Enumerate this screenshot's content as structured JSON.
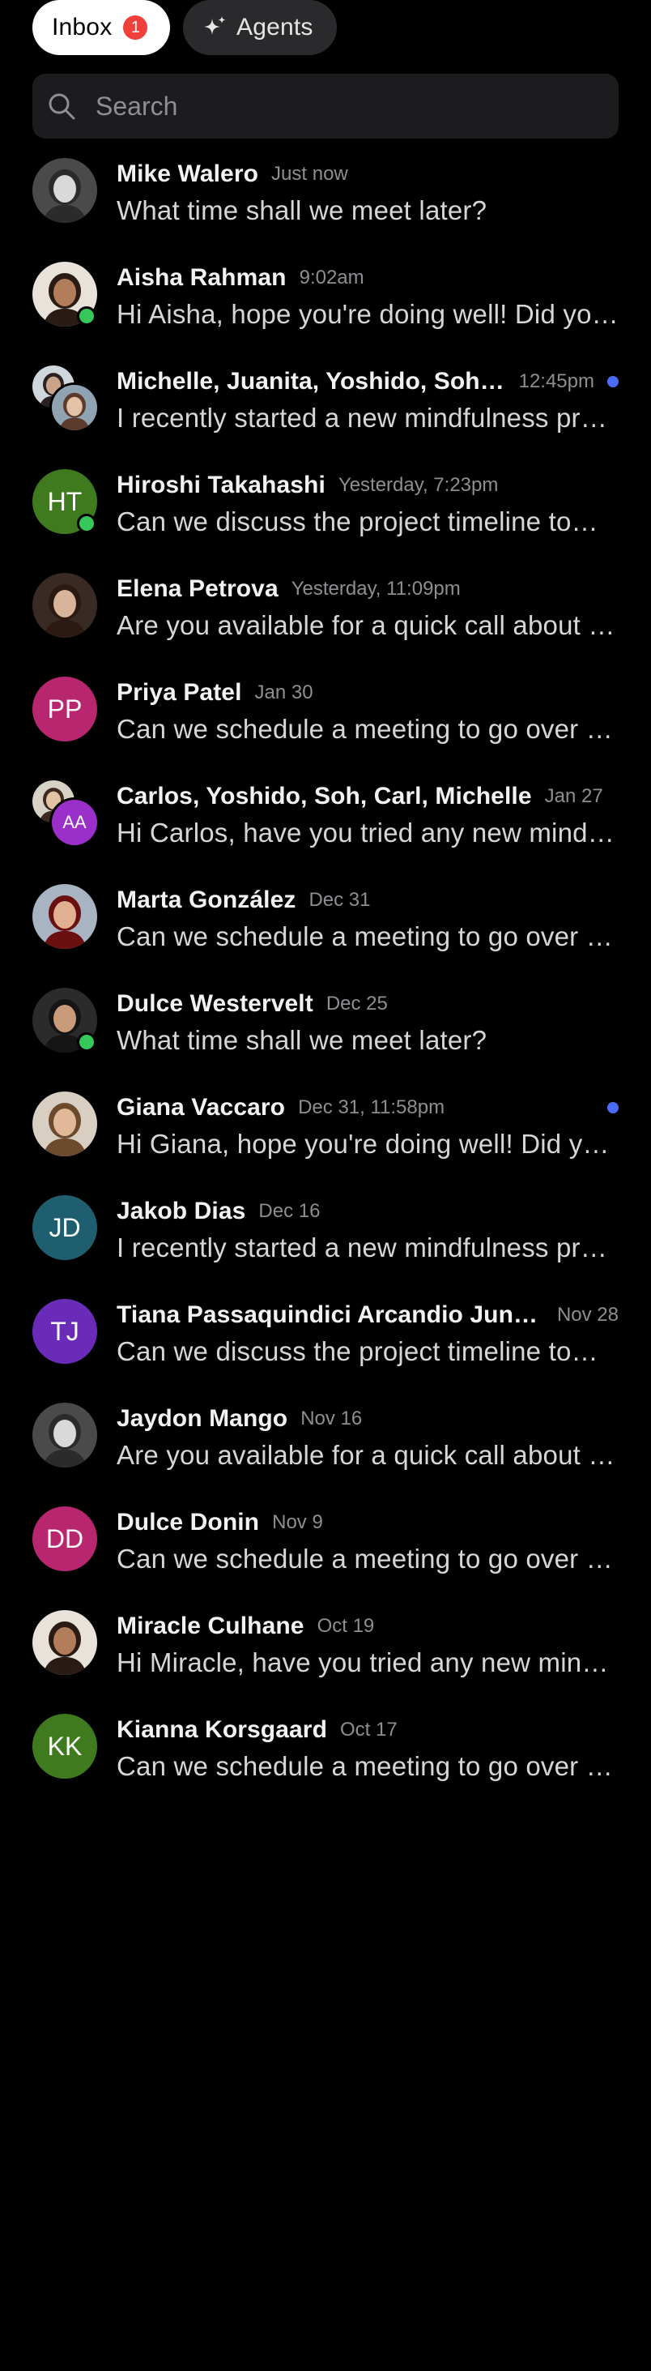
{
  "tabs": {
    "inbox": {
      "label": "Inbox",
      "badge": "1"
    },
    "agents": {
      "label": "Agents"
    }
  },
  "search": {
    "placeholder": "Search",
    "value": ""
  },
  "colors": {
    "unread_dot": "#4a6cf7",
    "online_dot": "#34c759",
    "badge": "#f0403c"
  },
  "conversations": [
    {
      "name": "Mike Walero",
      "time": "Just now",
      "preview": "What time shall we meet later?",
      "avatar": "photo",
      "online": false,
      "unread": false
    },
    {
      "name": "Aisha Rahman",
      "time": "9:02am",
      "preview": "Hi Aisha, hope you're doing well! Did you see the latest report?",
      "avatar": "photo",
      "online": true,
      "unread": false
    },
    {
      "name": "Michelle, Juanita, Yoshido, Soh, Carl",
      "time": "12:45pm",
      "preview": "I recently started a new mindfulness practice and it has helped a lot",
      "avatar": "group-photos",
      "online": false,
      "unread": true
    },
    {
      "name": "Hiroshi Takahashi",
      "time": "Yesterday, 7:23pm",
      "preview": "Can we discuss the project timeline tomorrow morning?",
      "avatar": "initials",
      "initials": "HT",
      "color": "#3f7a1f",
      "online": true,
      "unread": false
    },
    {
      "name": "Elena Petrova",
      "time": "Yesterday, 11:09pm",
      "preview": "Are you available for a quick call about the proposal?",
      "avatar": "photo",
      "online": false,
      "unread": false
    },
    {
      "name": "Priya Patel",
      "time": "Jan 30",
      "preview": "Can we schedule a meeting to go over the details?",
      "avatar": "initials",
      "initials": "PP",
      "color": "#b8266f",
      "online": false,
      "unread": false
    },
    {
      "name": "Carlos, Yoshido, Soh, Carl, Michelle",
      "time": "Jan 27",
      "preview": "Hi Carlos, have you tried any new mindfulness apps lately?",
      "avatar": "group-initials",
      "initials": "AA",
      "color": "#9b2fc9",
      "online": false,
      "unread": false
    },
    {
      "name": "Marta González",
      "time": "Dec 31",
      "preview": "Can we schedule a meeting to go over the details?",
      "avatar": "photo",
      "online": false,
      "unread": false
    },
    {
      "name": "Dulce Westervelt",
      "time": "Dec 25",
      "preview": "What time shall we meet later?",
      "avatar": "photo",
      "online": true,
      "unread": false
    },
    {
      "name": "Giana Vaccaro",
      "time": "Dec 31, 11:58pm",
      "preview": "Hi Giana, hope you're doing well! Did you see the latest report?",
      "avatar": "photo",
      "online": false,
      "unread": true
    },
    {
      "name": "Jakob Dias",
      "time": "Dec 16",
      "preview": "I recently started a new mindfulness practice and it has helped a lot",
      "avatar": "initials",
      "initials": "JD",
      "color": "#1f5e6e",
      "online": false,
      "unread": false
    },
    {
      "name": "Tiana Passaquindici Arcandio Junior",
      "time": "Nov 28",
      "preview": "Can we discuss the project timeline tomorrow morning?",
      "avatar": "initials",
      "initials": "TJ",
      "color": "#6a2bb8",
      "online": false,
      "unread": false
    },
    {
      "name": "Jaydon Mango",
      "time": "Nov 16",
      "preview": "Are you available for a quick call about the proposal?",
      "avatar": "photo",
      "online": false,
      "unread": false
    },
    {
      "name": "Dulce Donin",
      "time": "Nov 9",
      "preview": "Can we schedule a meeting to go over the details?",
      "avatar": "initials",
      "initials": "DD",
      "color": "#b8266f",
      "online": false,
      "unread": false
    },
    {
      "name": "Miracle Culhane",
      "time": "Oct 19",
      "preview": "Hi Miracle, have you tried any new mindfulness apps lately?",
      "avatar": "photo",
      "online": false,
      "unread": false
    },
    {
      "name": "Kianna Korsgaard",
      "time": "Oct 17",
      "preview": "Can we schedule a meeting to go over the details?",
      "avatar": "initials",
      "initials": "KK",
      "color": "#3f7a1f",
      "online": false,
      "unread": false
    }
  ]
}
